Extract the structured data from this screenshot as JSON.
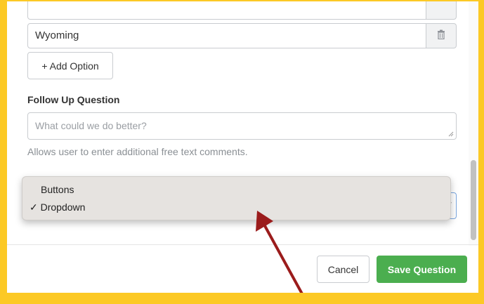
{
  "options": {
    "partial_value": "",
    "last_value": "Wyoming",
    "add_label": "+ Add Option"
  },
  "follow_up": {
    "label": "Follow Up Question",
    "placeholder": "What could we do better?",
    "help": "Allows user to enter additional free text comments."
  },
  "display_select": {
    "options": [
      "Buttons",
      "Dropdown"
    ],
    "selected": "Dropdown",
    "check_mark": "✓"
  },
  "footer": {
    "cancel_label": "Cancel",
    "save_label": "Save Question"
  },
  "colors": {
    "frame": "#fcc925",
    "save_button": "#4bae4f",
    "annotation_arrow": "#9b1c1c"
  },
  "icons": {
    "delete_option": "trash-icon",
    "select_caret": "chevron-down-icon",
    "annotation": "arrow-annotation"
  }
}
